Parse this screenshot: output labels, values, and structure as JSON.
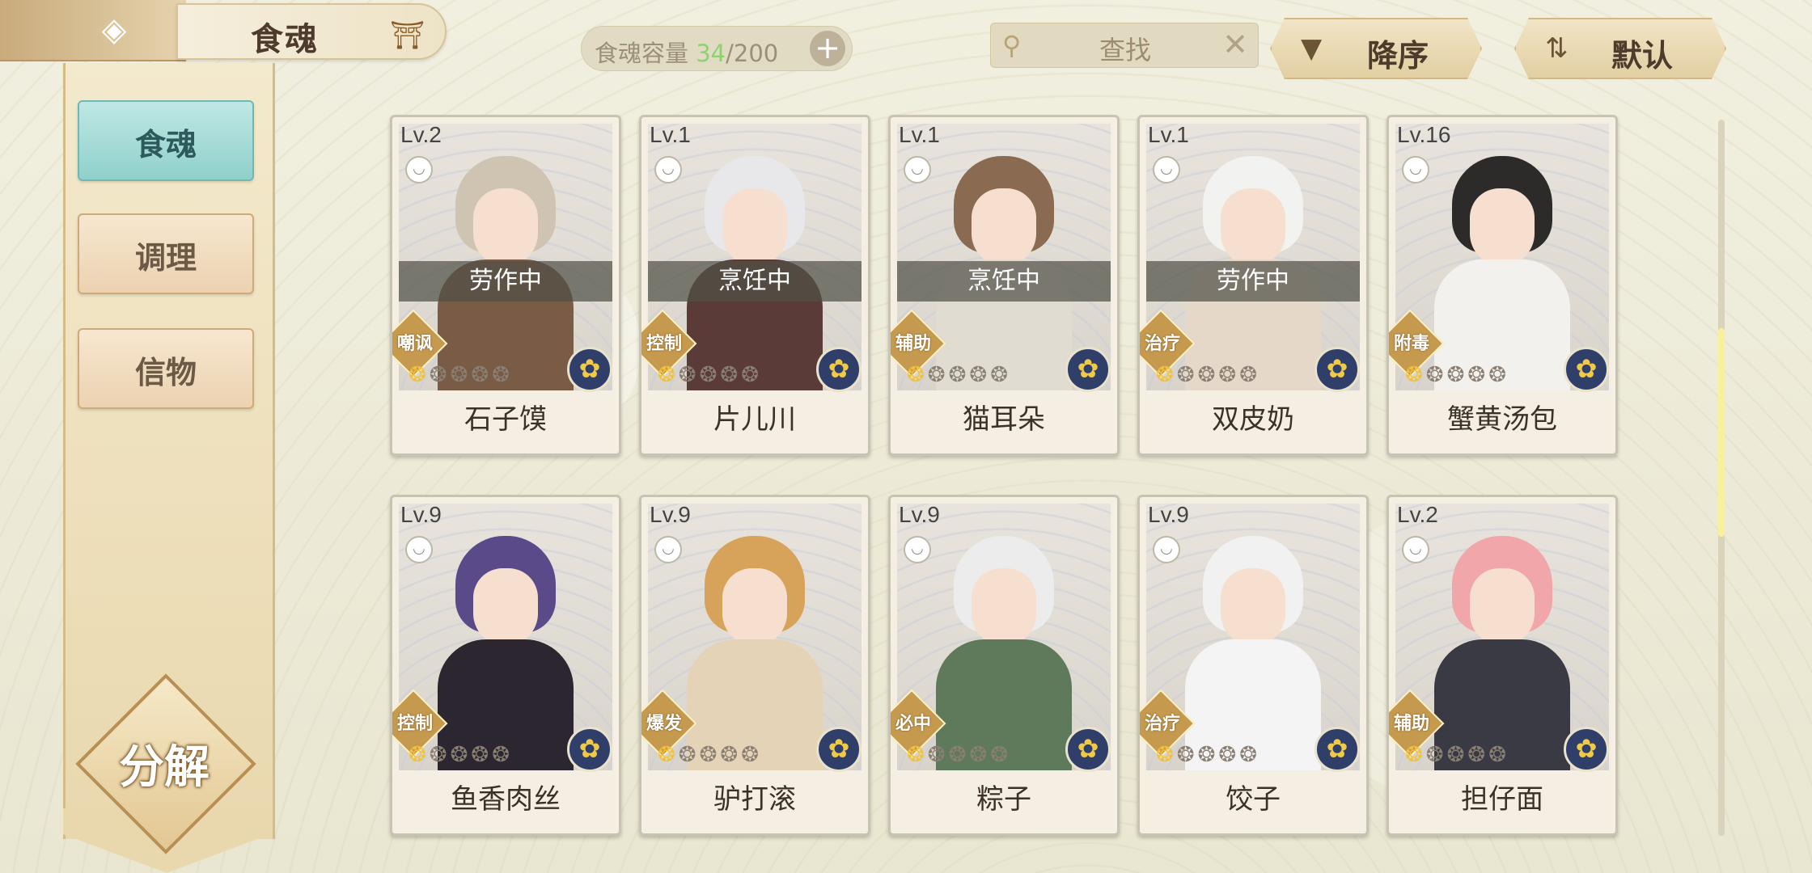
{
  "header": {
    "title": "食魂",
    "back_icon": "back-arrow-icon"
  },
  "capacity": {
    "label": "食魂容量 ",
    "current": "34",
    "max": "/200",
    "plus": "+"
  },
  "search": {
    "placeholder": "查找",
    "clear": "✕"
  },
  "sort": {
    "order_label": "降序",
    "default_label": "默认"
  },
  "sidebar": {
    "tabs": [
      {
        "label": "食魂"
      },
      {
        "label": "调理"
      },
      {
        "label": "信物"
      }
    ],
    "decompose_label": "分解"
  },
  "cards": [
    {
      "level": "Lv.2",
      "status": "劳作中",
      "role": "嘲讽",
      "name": "石子馍",
      "stars": 1
    },
    {
      "level": "Lv.1",
      "status": "烹饪中",
      "role": "控制",
      "name": "片儿川",
      "stars": 1
    },
    {
      "level": "Lv.1",
      "status": "烹饪中",
      "role": "辅助",
      "name": "猫耳朵",
      "stars": 1
    },
    {
      "level": "Lv.1",
      "status": "劳作中",
      "role": "治疗",
      "name": "双皮奶",
      "stars": 1
    },
    {
      "level": "Lv.16",
      "status": "",
      "role": "附毒",
      "name": "蟹黄汤包",
      "stars": 1
    },
    {
      "level": "Lv.9",
      "status": "",
      "role": "控制",
      "name": "鱼香肉丝",
      "stars": 1
    },
    {
      "level": "Lv.9",
      "status": "",
      "role": "爆发",
      "name": "驴打滚",
      "stars": 1
    },
    {
      "level": "Lv.9",
      "status": "",
      "role": "必中",
      "name": "粽子",
      "stars": 1
    },
    {
      "level": "Lv.9",
      "status": "",
      "role": "治疗",
      "name": "饺子",
      "stars": 1
    },
    {
      "level": "Lv.2",
      "status": "",
      "role": "辅助",
      "name": "担仔面",
      "stars": 1
    }
  ],
  "colors": {
    "accent_teal": "#90d0cb",
    "gold": "#c59a4e",
    "star_on": "#f0c23b"
  }
}
